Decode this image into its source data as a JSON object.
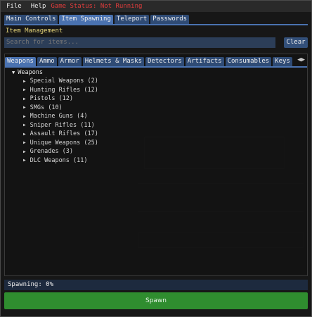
{
  "menu": {
    "file": "File",
    "help": "Help",
    "game_status": "Game Status: Not Running",
    "status_color": "#e03c3c"
  },
  "main_tabs": [
    {
      "label": "Main Controls",
      "active": false
    },
    {
      "label": "Item Spawning",
      "active": true
    },
    {
      "label": "Teleport",
      "active": false
    },
    {
      "label": "Passwords",
      "active": false
    }
  ],
  "section_title": "Item Management",
  "search": {
    "placeholder": "Search for items...",
    "value": "",
    "clear_label": "Clear"
  },
  "category_tabs": [
    {
      "label": "Weapons",
      "active": true
    },
    {
      "label": "Ammo",
      "active": false
    },
    {
      "label": "Armor",
      "active": false
    },
    {
      "label": "Helmets & Masks",
      "active": false
    },
    {
      "label": "Detectors",
      "active": false
    },
    {
      "label": "Artifacts",
      "active": false
    },
    {
      "label": "Consumables",
      "active": false
    },
    {
      "label": "Keys",
      "active": false
    }
  ],
  "category_scroll_arrows": "◀▶",
  "tree": {
    "root_label": "Weapons",
    "root_expanded_icon": "▼",
    "collapsed_icon": "▶",
    "items": [
      "Special Weapons (2)",
      "Hunting Rifles (12)",
      "Pistols (12)",
      "SMGs (10)",
      "Machine Guns (4)",
      "Sniper Rifles (11)",
      "Assault Rifles (17)",
      "Unique Weapons (25)",
      "Grenades (3)",
      "DLC Weapons (11)"
    ]
  },
  "spawning_status": "Spawning: 0%",
  "spawn_button": "Spawn",
  "colors": {
    "accent": "#4a72b0",
    "section_title": "#e8d77a",
    "spawn_button": "#2f8d2f"
  }
}
